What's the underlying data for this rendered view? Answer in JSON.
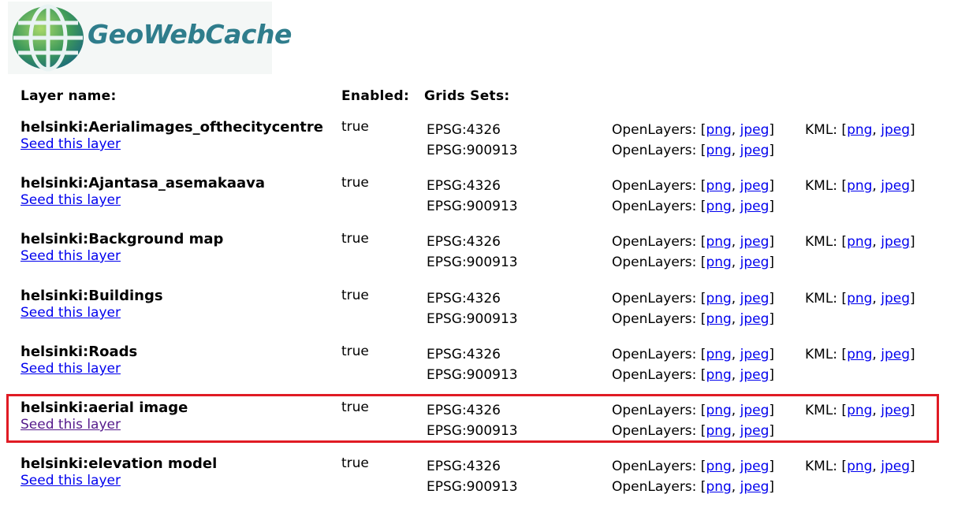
{
  "brand": {
    "name": "GeoWebCache"
  },
  "header": {
    "layer_name": "Layer name:",
    "enabled": "Enabled:",
    "grid_sets": "Grids Sets:"
  },
  "labels": {
    "seed": "Seed this layer",
    "openlayers": "OpenLayers:",
    "kml": "KML:",
    "png": "png",
    "jpeg": "jpeg"
  },
  "layers": [
    {
      "name": "helsinki:Aerialimages_ofthecitycentre",
      "enabled": "true",
      "grids": [
        "EPSG:4326",
        "EPSG:900913"
      ]
    },
    {
      "name": "helsinki:Ajantasa_asemakaava",
      "enabled": "true",
      "grids": [
        "EPSG:4326",
        "EPSG:900913"
      ]
    },
    {
      "name": "helsinki:Background map",
      "enabled": "true",
      "grids": [
        "EPSG:4326",
        "EPSG:900913"
      ]
    },
    {
      "name": "helsinki:Buildings",
      "enabled": "true",
      "grids": [
        "EPSG:4326",
        "EPSG:900913"
      ]
    },
    {
      "name": "helsinki:Roads",
      "enabled": "true",
      "grids": [
        "EPSG:4326",
        "EPSG:900913"
      ]
    },
    {
      "name": "helsinki:aerial image",
      "enabled": "true",
      "grids": [
        "EPSG:4326",
        "EPSG:900913"
      ],
      "highlighted": true,
      "seed_visited": true
    },
    {
      "name": "helsinki:elevation model",
      "enabled": "true",
      "grids": [
        "EPSG:4326",
        "EPSG:900913"
      ]
    }
  ],
  "colors": {
    "link": "#0000ee",
    "visited_link": "#551a8b",
    "highlight": "#e01b24",
    "brand": "#2f7d8c"
  }
}
